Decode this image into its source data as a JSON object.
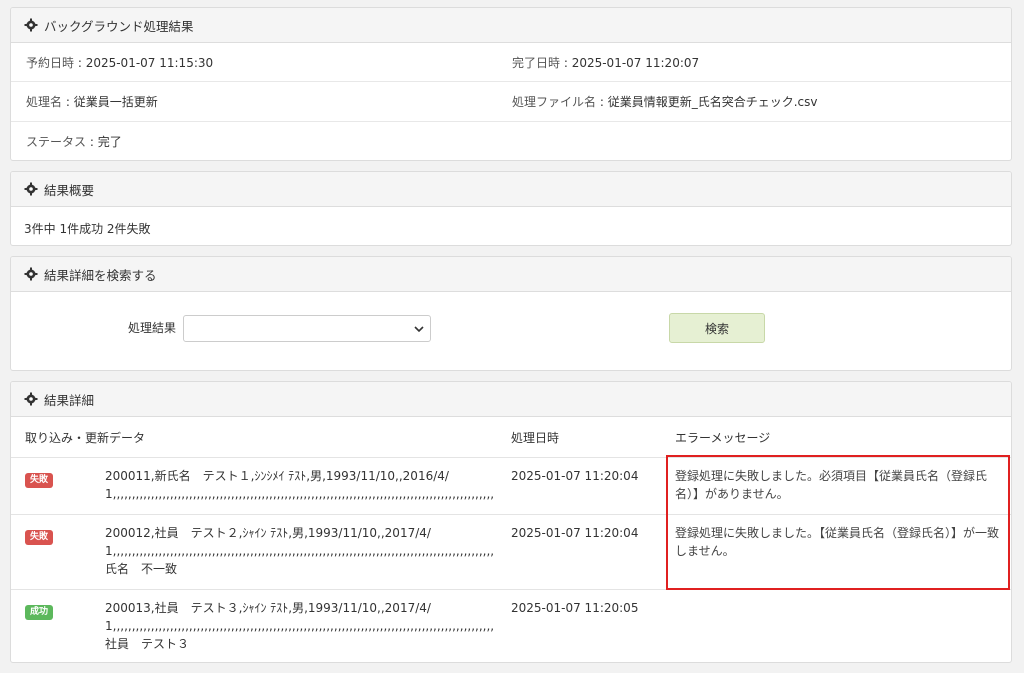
{
  "background_result": {
    "title": "バックグラウンド処理結果",
    "scheduled_label": "予約日時",
    "scheduled_value": "2025-01-07 11:15:30",
    "completed_label": "完了日時",
    "completed_value": "2025-01-07 11:20:07",
    "process_name_label": "処理名",
    "process_name_value": "従業員一括更新",
    "file_label": "処理ファイル名",
    "file_value": "従業員情報更新_氏名突合チェック.csv",
    "status_label": "ステータス",
    "status_value": "完了"
  },
  "summary": {
    "title": "結果概要",
    "text": "3件中 1件成功 2件失敗"
  },
  "search": {
    "title": "結果詳細を検索する",
    "result_label": "処理結果",
    "select_value": "",
    "button_label": "検索"
  },
  "details": {
    "title": "結果詳細",
    "col_data": "取り込み・更新データ",
    "col_date": "処理日時",
    "col_error": "エラーメッセージ",
    "rows": [
      {
        "status": "失敗",
        "line1": "200011,新氏名　テスト１,ｼﾝｼﾒｲ ﾃｽﾄ,男,1993/11/10,,2016/4/",
        "line2": "1,,,,,,,,,,,,,,,,,,,,,,,,,,,,,,,,,,,,,,,,,,,,,,,,,,,,,,,,,,,,,,,,,,,,,,,,,,,,,,,,,,,,,,,,,,,,,,,,,,,,,,,,,,,,,,,,,,,,,,,,,,,,,,,,,,,,,,,,,",
        "line3": "",
        "date": "2025-01-07 11:20:04",
        "error": "登録処理に失敗しました。必須項目【従業員氏名（登録氏名）】がありません。"
      },
      {
        "status": "失敗",
        "line1": "200012,社員　テスト２,ｼｬｲﾝ ﾃｽﾄ,男,1993/11/10,,2017/4/",
        "line2": "1,,,,,,,,,,,,,,,,,,,,,,,,,,,,,,,,,,,,,,,,,,,,,,,,,,,,,,,,,,,,,,,,,,,,,,,,,,,,,,,,,,,,,,,,,,,,,,,,,,,,,,,,,,,,,,,,,,,,,,,,,,,,,,,,,,,,,,,,,",
        "line3": "氏名　不一致",
        "date": "2025-01-07 11:20:04",
        "error": "登録処理に失敗しました。【従業員氏名（登録氏名）】が一致しません。"
      },
      {
        "status": "成功",
        "line1": "200013,社員　テスト３,ｼｬｲﾝ ﾃｽﾄ,男,1993/11/10,,2017/4/",
        "line2": "1,,,,,,,,,,,,,,,,,,,,,,,,,,,,,,,,,,,,,,,,,,,,,,,,,,,,,,,,,,,,,,,,,,,,,,,,,,,,,,,,,,,,,,,,,,,,,,,,,,,,,,,,,,,,,,,,,,,,,,,,,,,,,,,,,,,,,,,,,",
        "line3": "社員　テスト３",
        "date": "2025-01-07 11:20:05",
        "error": ""
      }
    ]
  },
  "colors": {
    "fail": "#d9534f",
    "success": "#5cb85c",
    "highlight": "#e02020"
  }
}
